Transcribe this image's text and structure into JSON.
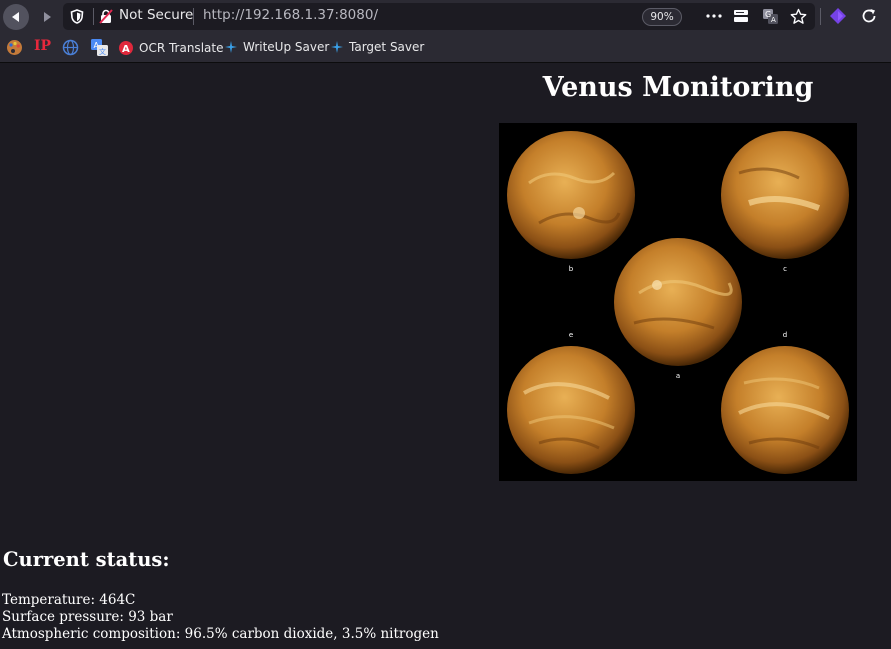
{
  "browser": {
    "security_label": "Not Secure",
    "url": "http://192.168.1.37:8080/",
    "zoom": "90%"
  },
  "bookmarks": [
    {
      "label": "",
      "icon": "palette-icon"
    },
    {
      "label": "IP",
      "icon": "ip-text-icon"
    },
    {
      "label": "",
      "icon": "globe-icon"
    },
    {
      "label": "",
      "icon": "translate-icon"
    },
    {
      "label": "OCR Translate",
      "icon": "ocr-translate-icon"
    },
    {
      "label": "WriteUp Saver",
      "icon": "writeup-saver-icon"
    },
    {
      "label": "Target Saver",
      "icon": "target-saver-icon"
    }
  ],
  "page": {
    "title": "Venus Monitoring",
    "image_labels": [
      "b",
      "c",
      "e",
      "d",
      "a"
    ],
    "status_heading": "Current status:",
    "status_lines": [
      "Temperature: 464C",
      "Surface pressure: 93 bar",
      "Atmospheric composition: 96.5% carbon dioxide, 3.5% nitrogen"
    ]
  },
  "colors": {
    "toolbar_bg": "#2b2a33",
    "page_bg": "#1c1b22",
    "text": "#ffffff",
    "planet_accent": "#d4952b",
    "extension_accent": "#7542e5"
  }
}
